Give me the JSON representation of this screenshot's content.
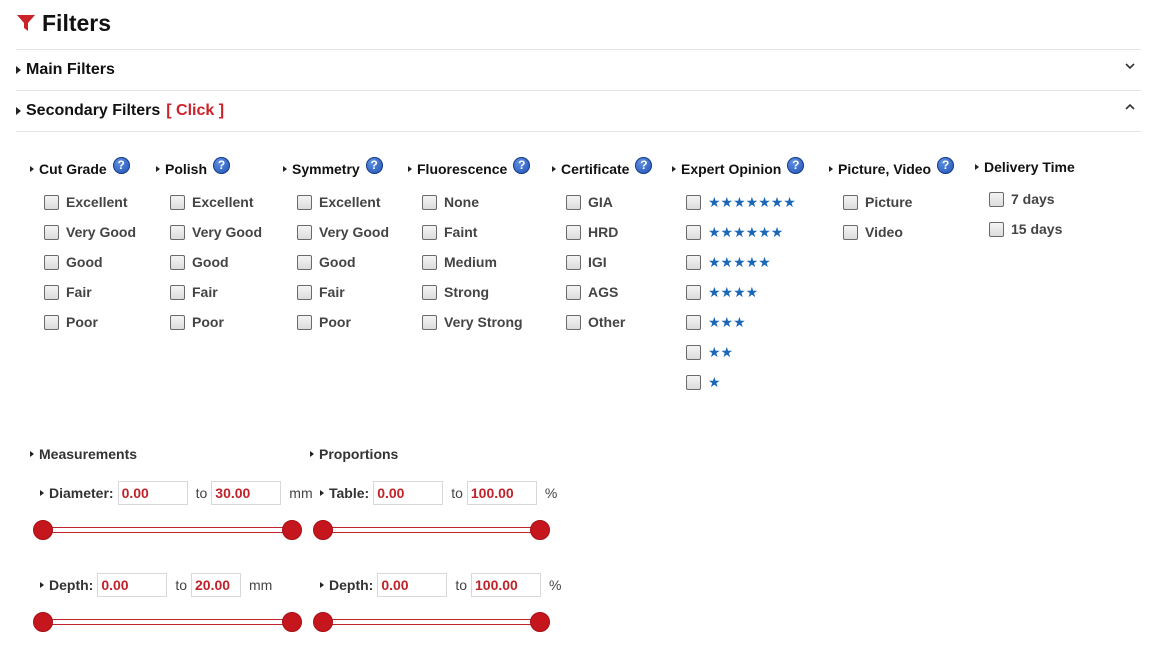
{
  "header": {
    "title": "Filters"
  },
  "sections": {
    "main": {
      "label": "Main Filters"
    },
    "secondary": {
      "label": "Secondary Filters",
      "click_label": "[ Click ]"
    }
  },
  "columns": [
    {
      "title": "Cut Grade",
      "options": [
        "Excellent",
        "Very Good",
        "Good",
        "Fair",
        "Poor"
      ]
    },
    {
      "title": "Polish",
      "options": [
        "Excellent",
        "Very Good",
        "Good",
        "Fair",
        "Poor"
      ]
    },
    {
      "title": "Symmetry",
      "options": [
        "Excellent",
        "Very Good",
        "Good",
        "Fair",
        "Poor"
      ]
    },
    {
      "title": "Fluorescence",
      "options": [
        "None",
        "Faint",
        "Medium",
        "Strong",
        "Very Strong"
      ]
    },
    {
      "title": "Certificate",
      "options": [
        "GIA",
        "HRD",
        "IGI",
        "AGS",
        "Other"
      ]
    },
    {
      "title": "Expert Opinion",
      "options": [
        "★★★★★★★",
        "★★★★★★",
        "★★★★★",
        "★★★★",
        "★★★",
        "★★",
        "★"
      ]
    },
    {
      "title": "Picture, Video",
      "options": [
        "Picture",
        "Video"
      ]
    },
    {
      "title": "Delivery Time",
      "options": [
        "7 days",
        "15 days"
      ]
    }
  ],
  "help_glyph": "?",
  "measurements": {
    "title": "Measurements",
    "diameter": {
      "label": "Diameter:",
      "min": "0.00",
      "max": "30.00",
      "to": "to",
      "unit": "mm"
    },
    "depth": {
      "label": "Depth:",
      "min": "0.00",
      "max": "20.00",
      "to": "to",
      "unit": "mm"
    }
  },
  "proportions": {
    "title": "Proportions",
    "table": {
      "label": "Table:",
      "min": "0.00",
      "max": "100.00",
      "to": "to",
      "unit": "%"
    },
    "depth": {
      "label": "Depth:",
      "min": "0.00",
      "max": "100.00",
      "to": "to",
      "unit": "%"
    }
  },
  "colors": {
    "accent": "#cc2229",
    "star": "#1a67b8",
    "help": "#1f4fb3"
  }
}
